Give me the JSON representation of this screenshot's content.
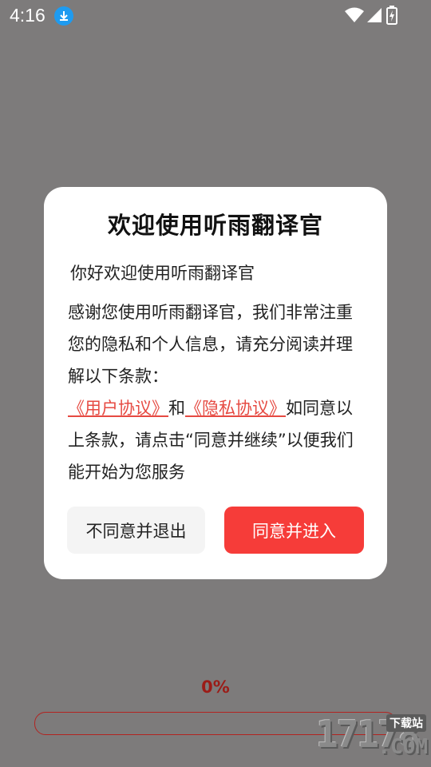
{
  "status_bar": {
    "time": "4:16",
    "icons": [
      "download-icon",
      "wifi-icon",
      "signal-icon",
      "battery-charging-icon"
    ]
  },
  "dialog": {
    "title": "欢迎使用听雨翻译官",
    "greeting": "你好欢迎使用听雨翻译官",
    "intro": "感谢您使用听雨翻译官，我们非常注重您的隐私和个人信息，请充分阅读并理解以下条款：",
    "user_agreement_link": "《用户协议》",
    "and_text": "和",
    "privacy_policy_link": "《隐私协议》",
    "closing": "如同意以上条款，请点击“同意并继续”以便我们能开始为您服务",
    "decline_button": "不同意并退出",
    "accept_button": "同意并进入"
  },
  "loading": {
    "progress_text": "0%",
    "progress_fraction": 0
  },
  "watermark": {
    "number": "17178",
    "site_label": "下载站",
    "domain_suffix": ".COM"
  },
  "colors": {
    "accent": "#f63c39",
    "link": "#e64a42",
    "overlay": "#7d7b7b"
  }
}
